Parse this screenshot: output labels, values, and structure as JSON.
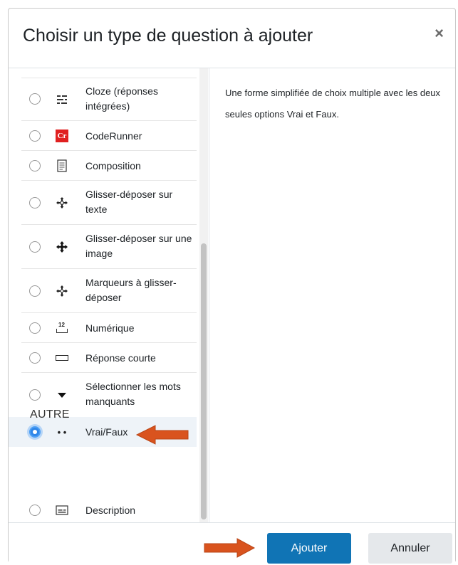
{
  "dialog": {
    "title": "Choisir un type de question à ajouter",
    "close_glyph": "×"
  },
  "options": [
    {
      "label": "Cloze (réponses intégrées)",
      "icon": "cloze-icon",
      "selected": false
    },
    {
      "label": "CodeRunner",
      "icon": "coderunner-icon",
      "selected": false
    },
    {
      "label": "Composition",
      "icon": "composition-icon",
      "selected": false
    },
    {
      "label": "Glisser-déposer sur texte",
      "icon": "drag-text-icon",
      "selected": false
    },
    {
      "label": "Glisser-déposer sur une image",
      "icon": "drag-image-icon",
      "selected": false
    },
    {
      "label": "Marqueurs à glisser-déposer",
      "icon": "drag-markers-icon",
      "selected": false
    },
    {
      "label": "Numérique",
      "icon": "numerical-icon",
      "selected": false
    },
    {
      "label": "Réponse courte",
      "icon": "short-answer-icon",
      "selected": false
    },
    {
      "label": "Sélectionner les mots manquants",
      "icon": "select-missing-words-icon",
      "selected": false
    },
    {
      "label": "Vrai/Faux",
      "icon": "true-false-icon",
      "selected": true
    }
  ],
  "section_other": "AUTRE",
  "other_options": [
    {
      "label": "Description",
      "icon": "description-icon",
      "selected": false
    }
  ],
  "description_text": "Une forme simplifiée de choix multiple avec les deux seules options Vrai et Faux.",
  "footer": {
    "add_label": "Ajouter",
    "cancel_label": "Annuler"
  },
  "colors": {
    "primary": "#1074b5",
    "annotation_arrow": "#d9531e",
    "coderunner_badge": "#e02020"
  },
  "icon_glyphs": {
    "coderunner": "Cr",
    "numerical": "12",
    "true_false": "• •"
  }
}
